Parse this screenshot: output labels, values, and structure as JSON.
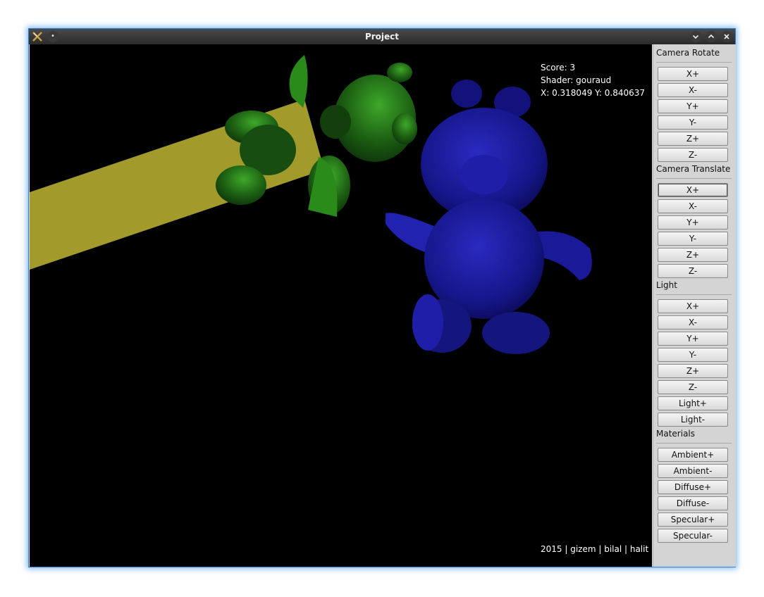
{
  "window": {
    "title": "Project"
  },
  "hud": {
    "score": "Score: 3",
    "shader": "Shader: gouraud",
    "coords": "X: 0.318049 Y: 0.840637",
    "credits": "2015 | gizem | bilal | halit"
  },
  "panel": {
    "camera_rotate": {
      "label": "Camera Rotate",
      "buttons": [
        "X+",
        "X-",
        "Y+",
        "Y-",
        "Z+",
        "Z-"
      ]
    },
    "camera_translate": {
      "label": "Camera Translate",
      "buttons": [
        "X+",
        "X-",
        "Y+",
        "Y-",
        "Z+",
        "Z-"
      ]
    },
    "light": {
      "label": "Light",
      "buttons": [
        "X+",
        "X-",
        "Y+",
        "Y-",
        "Z+",
        "Z-",
        "Light+",
        "Light-"
      ]
    },
    "materials": {
      "label": "Materials",
      "buttons": [
        "Ambient+",
        "Ambient-",
        "Diffuse+",
        "Diffuse-",
        "Specular+",
        "Specular-"
      ]
    }
  },
  "colors": {
    "viewport_bg": "#000000",
    "floor": "#a29a2a",
    "green_bear": "#1f6a12",
    "blue_bear": "#1a1a8c",
    "window_glow": "#3c96e6"
  },
  "icons": {
    "app": "app-logo-icon",
    "menu": "window-menu-icon",
    "minimize": "chevron-down-icon",
    "maximize": "chevron-up-icon",
    "close": "close-icon"
  }
}
